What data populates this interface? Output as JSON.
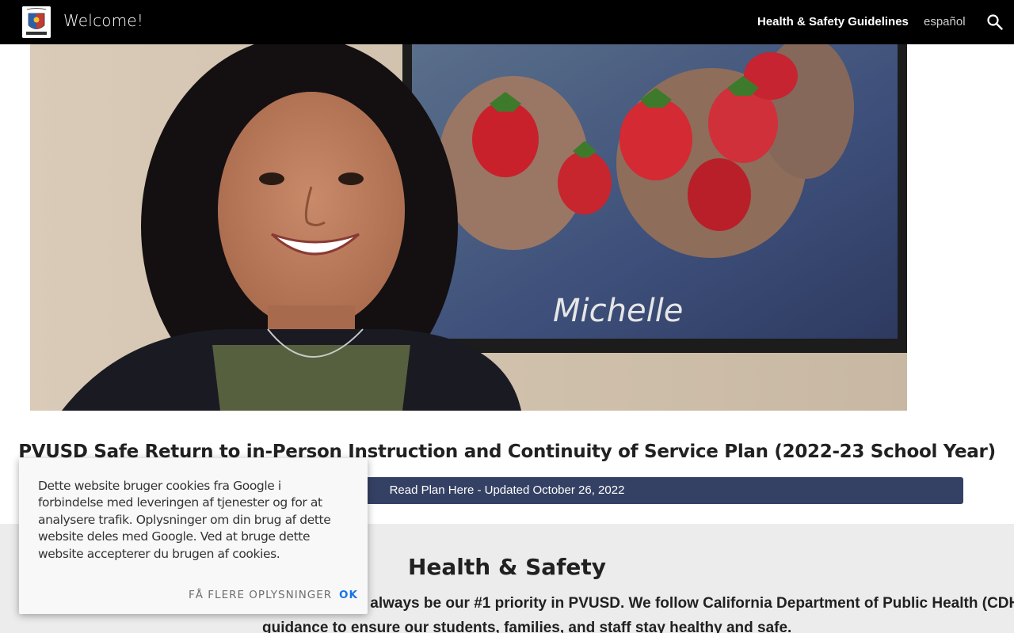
{
  "header": {
    "site_title": "Welcome!",
    "nav": [
      {
        "label": "Health & Safety Guidelines",
        "active": true
      },
      {
        "label": "español",
        "active": false
      }
    ],
    "search_icon": "search-icon",
    "logo_icon": "school-crest-logo"
  },
  "hero": {
    "signature": "Michelle"
  },
  "plan": {
    "title": "PVUSD Safe Return to in-Person Instruction and Continuity of Service Plan (2022-23 School Year)",
    "button_label": "Read Plan Here - Updated October 26, 2022"
  },
  "health_safety": {
    "heading": "Health & Safety",
    "line1": "Your health and safety will always be our #1 priority in PVUSD. We follow California Department of Public Health (CDHP)",
    "line2": "guidance to ensure our students, families, and staff stay healthy and safe."
  },
  "cookie": {
    "text": "Dette website bruger cookies fra Google i forbindelse med leveringen af tjenester og for at analysere trafik. Oplysninger om din brug af dette website deles med Google. Ved at bruge dette website accepterer du brugen af cookies.",
    "more_label": "FÅ FLERE OPLYSNINGER",
    "ok_label": "OK"
  },
  "colors": {
    "header_bg": "#000000",
    "button_bg": "#354164",
    "section_bg": "#ececec",
    "ok_color": "#1a73e8"
  }
}
